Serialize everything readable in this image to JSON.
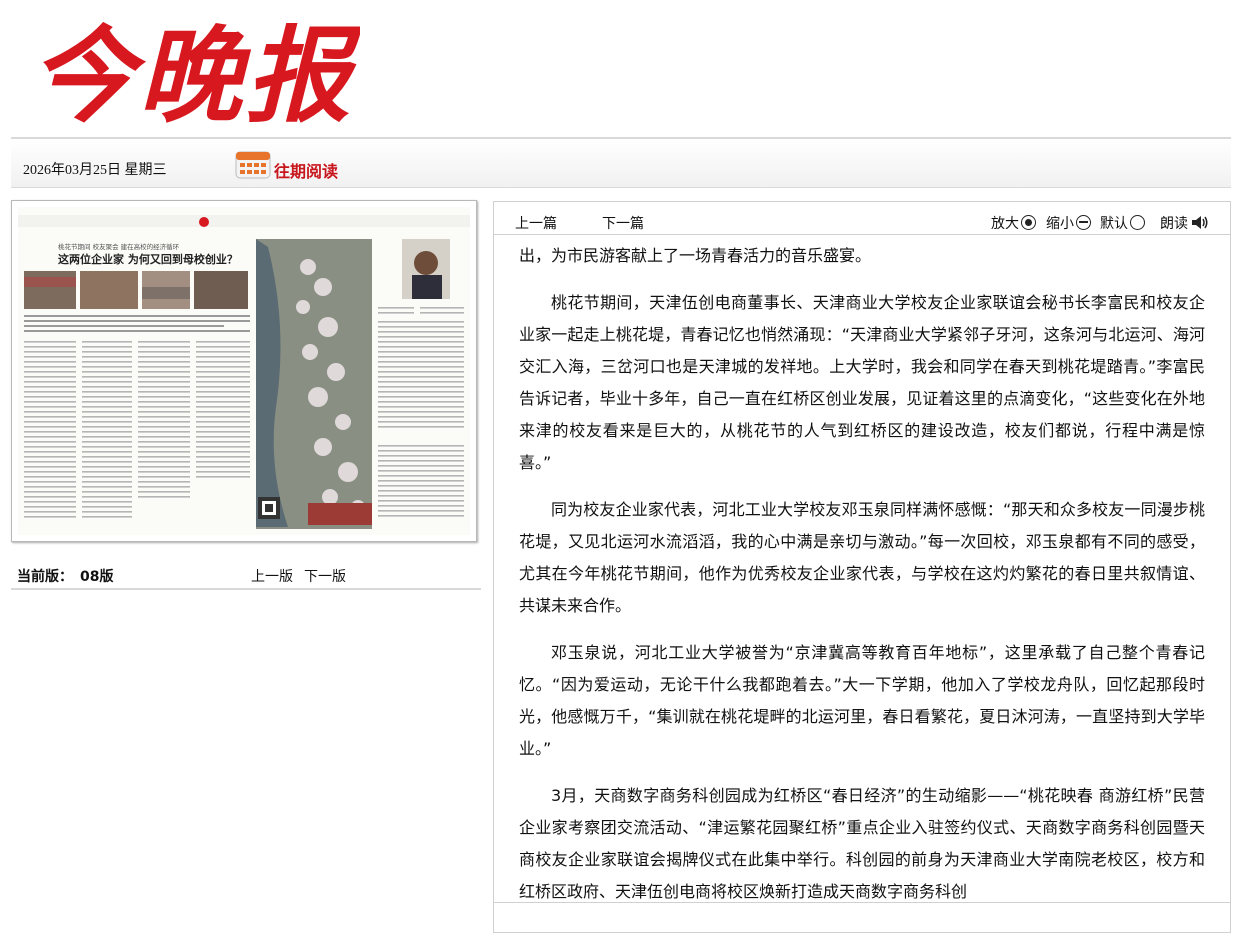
{
  "masthead": {
    "title": "今晚报",
    "color": "#d8181f"
  },
  "datebar": {
    "date": "2026年03月25日 星期三",
    "archive_label": "往期阅读",
    "archive_icon": "calendar-icon"
  },
  "thumbnail": {
    "headline": "这两位企业家 为何又回到母校创业？",
    "kicker": "桃花节期间 校友聚会 建在高校的经济循环"
  },
  "edition": {
    "label": "当前版：",
    "value": "08版",
    "prev_label": "上一版",
    "next_label": "下一版"
  },
  "toolbar": {
    "prev_article": "上一篇",
    "next_article": "下一篇",
    "zoom_in": "放大",
    "zoom_out": "缩小",
    "default": "默认",
    "read_aloud": "朗读",
    "read_icon": "speaker-icon"
  },
  "article": {
    "paragraphs": [
      "出，为市民游客献上了一场青春活力的音乐盛宴。",
      "桃花节期间，天津伍创电商董事长、天津商业大学校友企业家联谊会秘书长李富民和校友企业家一起走上桃花堤，青春记忆也悄然涌现：“天津商业大学紧邻子牙河，这条河与北运河、海河交汇入海，三岔河口也是天津城的发祥地。上大学时，我会和同学在春天到桃花堤踏青。”李富民告诉记者，毕业十多年，自己一直在红桥区创业发展，见证着这里的点滴变化，“这些变化在外地来津的校友看来是巨大的，从桃花节的人气到红桥区的建设改造，校友们都说，行程中满是惊喜。”",
      "同为校友企业家代表，河北工业大学校友邓玉泉同样满怀感慨：“那天和众多校友一同漫步桃花堤，又见北运河水流滔滔，我的心中满是亲切与激动。”每一次回校，邓玉泉都有不同的感受，尤其在今年桃花节期间，他作为优秀校友企业家代表，与学校在这灼灼繁花的春日里共叙情谊、共谋未来合作。",
      "邓玉泉说，河北工业大学被誉为“京津冀高等教育百年地标”，这里承载了自己整个青春记忆。“因为爱运动，无论干什么我都跑着去。”大一下学期，他加入了学校龙舟队，回忆起那段时光，他感慨万千，“集训就在桃花堤畔的北运河里，春日看繁花，夏日沐河涛，一直坚持到大学毕业。”",
      "3月，天商数字商务科创园成为红桥区“春日经济”的生动缩影——“桃花映春 商游红桥”民营企业家考察团交流活动、“津运繁花园聚红桥”重点企业入驻签约仪式、天商数字商务科创园暨天商校友企业家联谊会揭牌仪式在此集中举行。科创园的前身为天津商业大学南院老校区，校方和红桥区政府、天津伍创电商将校区焕新打造成天商数字商务科创"
    ]
  }
}
